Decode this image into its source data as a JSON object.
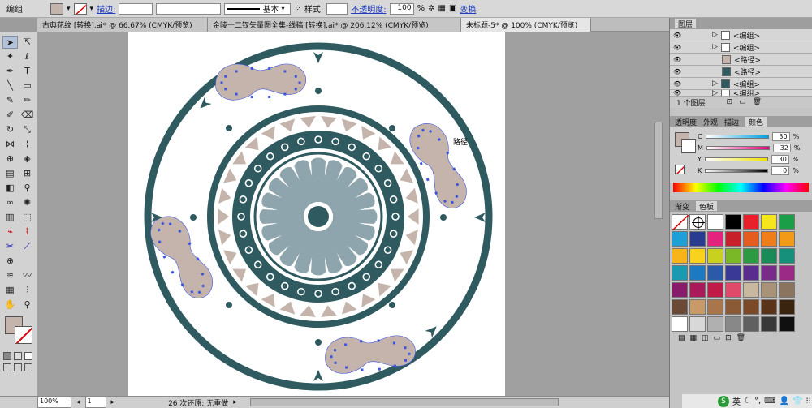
{
  "control_bar": {
    "selection_type": "编组",
    "stroke_label": "描边:",
    "profile_label": "基本",
    "style_label": "样式:",
    "opacity_label": "不透明度:",
    "opacity_value": "100",
    "opacity_unit": "%",
    "transform_label": "变换"
  },
  "tabs": [
    {
      "label": "古典花纹 [转换].ai* @ 66.67% (CMYK/预览)"
    },
    {
      "label": "金陵十二钗矢量图全集-线稿 [转换].ai* @ 206.12% (CMYK/预览)"
    },
    {
      "label": "未标题-5* @ 100% (CMYK/预览)"
    }
  ],
  "canvas": {
    "path_hint": "路径"
  },
  "status": {
    "zoom": "100%",
    "page": "1",
    "undo_text": "26 次还原; 无重做"
  },
  "layers_panel": {
    "title": "图层",
    "rows": [
      {
        "label": "<编组>"
      },
      {
        "label": "<编组>"
      },
      {
        "label": "<路径>"
      },
      {
        "label": "<路径>"
      },
      {
        "label": "<编组>"
      },
      {
        "label": "<编组>"
      }
    ],
    "footer": "1 个图层"
  },
  "color_panel": {
    "tabs": [
      "透明度",
      "外观",
      "描边",
      "颜色"
    ],
    "active_tab": "颜色",
    "channels": [
      {
        "name": "C",
        "value": "30"
      },
      {
        "name": "M",
        "value": "32"
      },
      {
        "name": "Y",
        "value": "30"
      },
      {
        "name": "K",
        "value": "0"
      }
    ],
    "unit": "%"
  },
  "swatches_panel": {
    "tabs": [
      "渐变",
      "色板"
    ],
    "active_tab": "色板"
  },
  "taskbar": {
    "ime": "英"
  },
  "colors": {
    "teal": "#2f5a60",
    "beige": "#c4b4ab",
    "light_blue": "#8fa5ae",
    "selection": "#3a55e0"
  }
}
